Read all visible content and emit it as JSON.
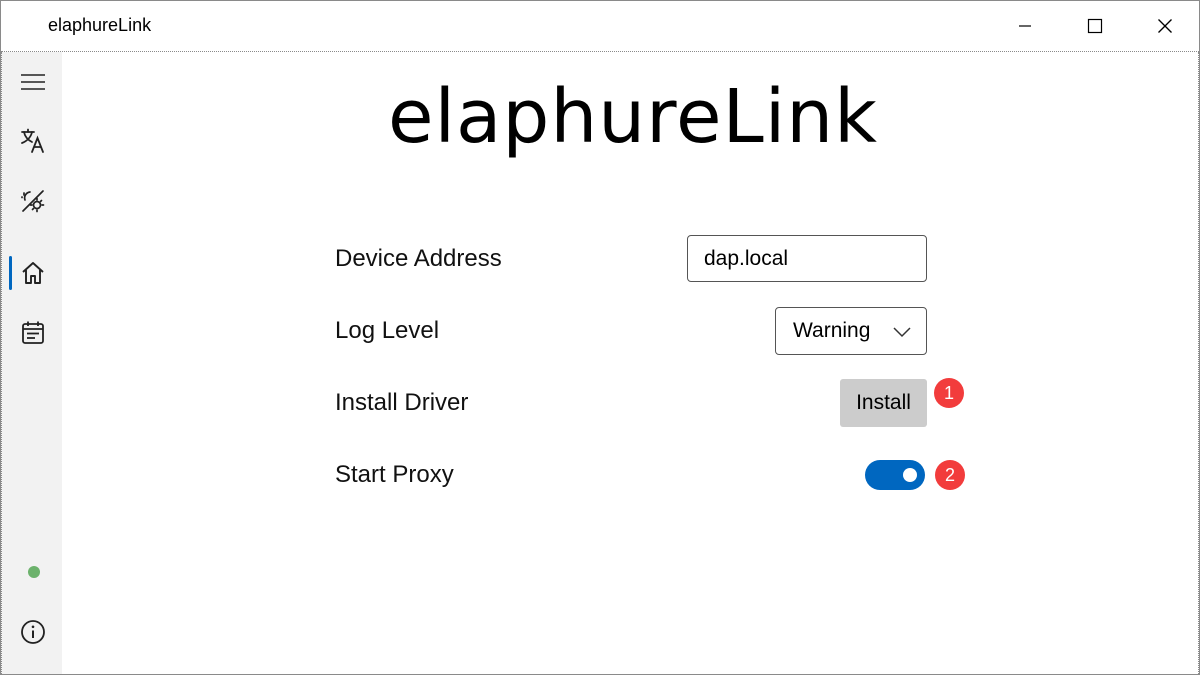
{
  "window": {
    "title": "elaphureLink"
  },
  "sidebar": {
    "items": [
      {
        "name": "menu",
        "icon": "hamburger-menu-icon"
      },
      {
        "name": "language",
        "icon": "translate-icon"
      },
      {
        "name": "theme",
        "icon": "theme-toggle-icon"
      },
      {
        "name": "home",
        "icon": "home-icon",
        "selected": true
      },
      {
        "name": "log",
        "icon": "calendar-log-icon"
      }
    ],
    "status_color": "#6cb26c",
    "footer_icon": "info-icon"
  },
  "main": {
    "brand": "elaphureLink",
    "device_address": {
      "label": "Device Address",
      "value": "dap.local"
    },
    "log_level": {
      "label": "Log Level",
      "value": "Warning"
    },
    "install_driver": {
      "label": "Install Driver",
      "button_label": "Install",
      "badge": "1"
    },
    "start_proxy": {
      "label": "Start Proxy",
      "enabled": true,
      "badge": "2"
    }
  },
  "colors": {
    "accent": "#0067c0",
    "badge": "#f23c3c",
    "button_bg": "#cccccc",
    "sidebar_bg": "#f2f2f2"
  }
}
